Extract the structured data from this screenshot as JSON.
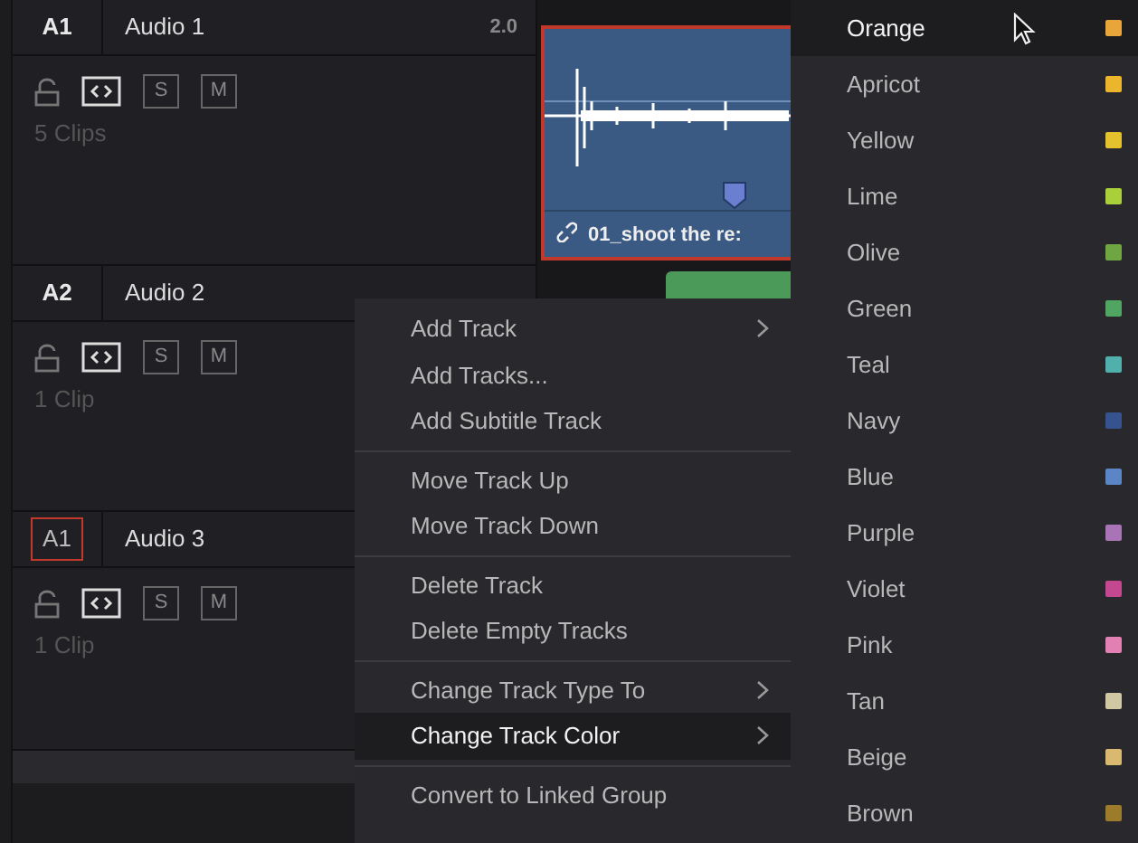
{
  "tracks": [
    {
      "id": "A1",
      "name": "Audio 1",
      "format": "2.0",
      "solo": "S",
      "mute": "M",
      "clips": "5 Clips",
      "id_outlined": false
    },
    {
      "id": "A2",
      "name": "Audio 2",
      "solo": "S",
      "mute": "M",
      "clips": "1 Clip",
      "id_outlined": false
    },
    {
      "id": "A1",
      "name": "Audio 3",
      "solo": "S",
      "mute": "M",
      "clips": "1 Clip",
      "id_outlined": true
    }
  ],
  "timeline": {
    "clip_name": "01_shoot the re:",
    "clip_selected": true
  },
  "context_menu": {
    "groups": [
      [
        {
          "label": "Add Track",
          "submenu": true,
          "selected": false
        },
        {
          "label": "Add Tracks...",
          "submenu": false,
          "selected": false
        },
        {
          "label": "Add Subtitle Track",
          "submenu": false,
          "selected": false
        }
      ],
      [
        {
          "label": "Move Track Up",
          "submenu": false,
          "selected": false
        },
        {
          "label": "Move Track Down",
          "submenu": false,
          "selected": false
        }
      ],
      [
        {
          "label": "Delete Track",
          "submenu": false,
          "selected": false
        },
        {
          "label": "Delete Empty Tracks",
          "submenu": false,
          "selected": false
        }
      ],
      [
        {
          "label": "Change Track Type To",
          "submenu": true,
          "selected": false
        },
        {
          "label": "Change Track Color",
          "submenu": true,
          "selected": true
        }
      ],
      [
        {
          "label": "Convert to Linked Group",
          "submenu": false,
          "selected": false
        }
      ]
    ]
  },
  "color_menu": [
    {
      "label": "Orange",
      "color": "#e8a63a",
      "selected": true
    },
    {
      "label": "Apricot",
      "color": "#ebb62c",
      "selected": false
    },
    {
      "label": "Yellow",
      "color": "#e3c22e",
      "selected": false
    },
    {
      "label": "Lime",
      "color": "#a9cf3a",
      "selected": false
    },
    {
      "label": "Olive",
      "color": "#6ea641",
      "selected": false
    },
    {
      "label": "Green",
      "color": "#4fa561",
      "selected": false
    },
    {
      "label": "Teal",
      "color": "#4fb0ac",
      "selected": false
    },
    {
      "label": "Navy",
      "color": "#34538f",
      "selected": false
    },
    {
      "label": "Blue",
      "color": "#5b86c6",
      "selected": false
    },
    {
      "label": "Purple",
      "color": "#a874b6",
      "selected": false
    },
    {
      "label": "Violet",
      "color": "#c4488f",
      "selected": false
    },
    {
      "label": "Pink",
      "color": "#e27fb3",
      "selected": false
    },
    {
      "label": "Tan",
      "color": "#cfc8a2",
      "selected": false
    },
    {
      "label": "Beige",
      "color": "#d9b96f",
      "selected": false
    },
    {
      "label": "Brown",
      "color": "#9c7b2b",
      "selected": false
    }
  ]
}
